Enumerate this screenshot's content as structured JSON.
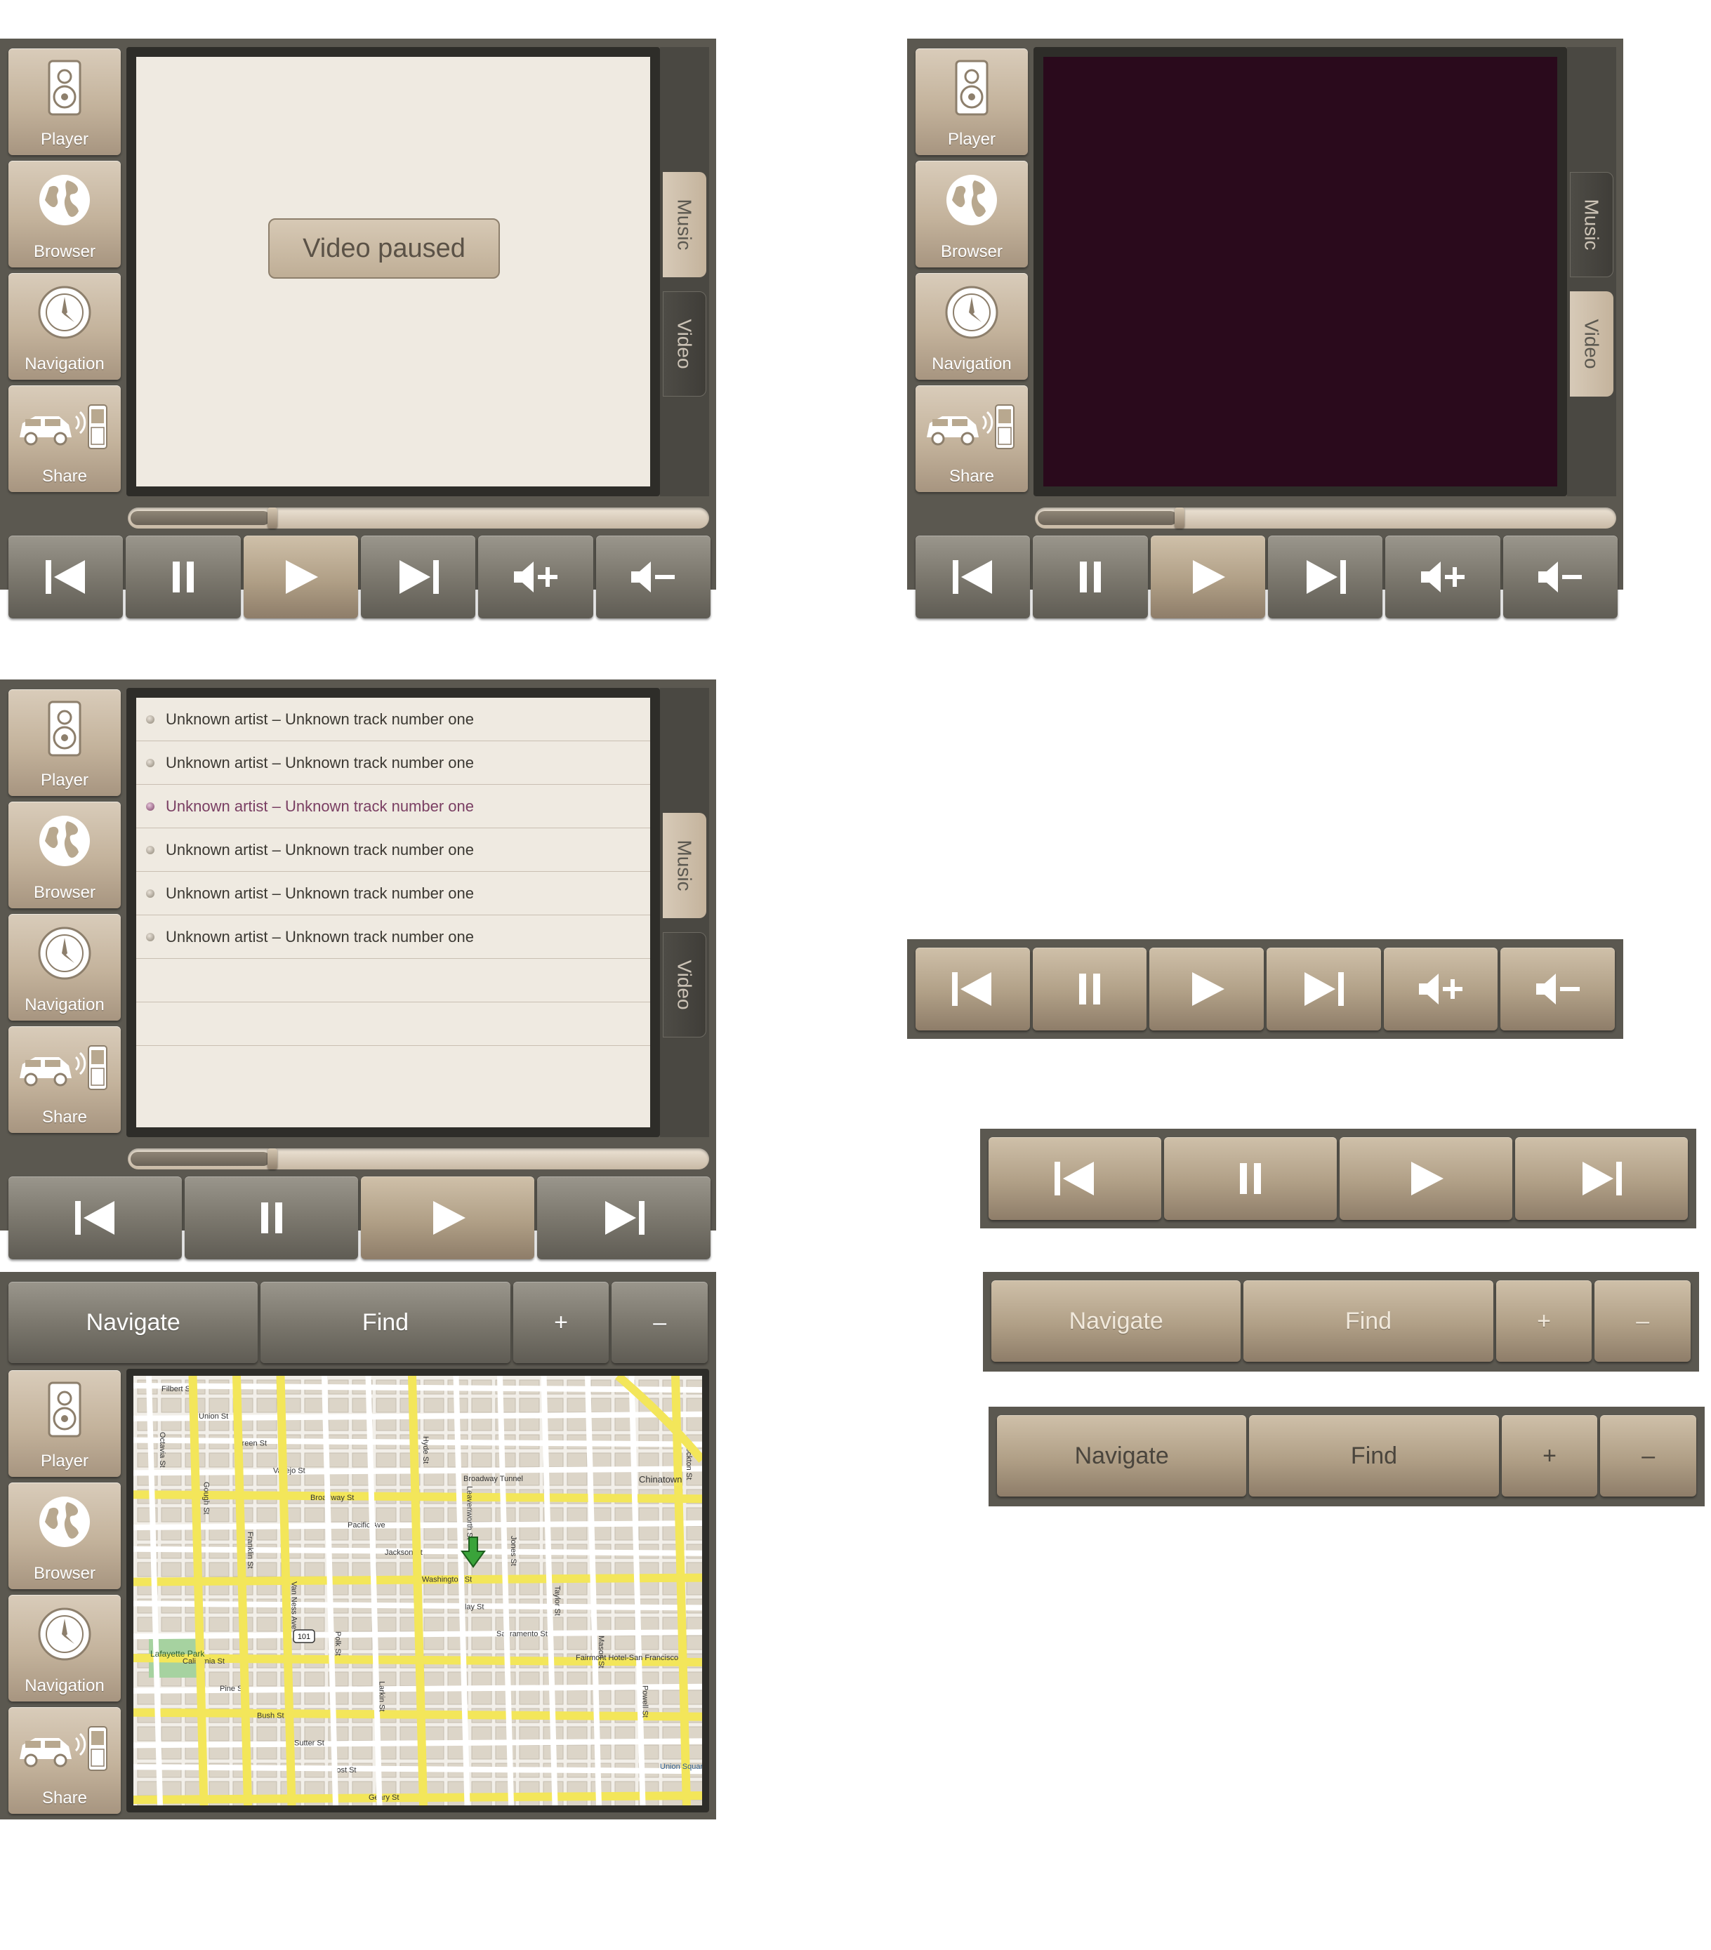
{
  "sidebar": {
    "player": "Player",
    "browser": "Browser",
    "navigation": "Navigation",
    "share": "Share"
  },
  "tabs": {
    "music": "Music",
    "video": "Video"
  },
  "video_screen": {
    "paused_label": "Video paused"
  },
  "playlist": {
    "tracks": [
      "Unknown artist – Unknown track number one",
      "Unknown artist – Unknown track number one",
      "Unknown artist – Unknown track number one",
      "Unknown artist – Unknown track number one",
      "Unknown artist – Unknown track number one",
      "Unknown artist – Unknown track number one"
    ],
    "selected_index": 2
  },
  "progress": {
    "fraction": 0.24
  },
  "map_toolbar": {
    "navigate": "Navigate",
    "find": "Find",
    "zoom_in": "+",
    "zoom_out": "–"
  },
  "map": {
    "streets": {
      "horizontal": [
        "Filbert St",
        "Union St",
        "Green St",
        "Vallejo St",
        "Broadway St",
        "Pacific Ave",
        "Jackson St",
        "Washington St",
        "Clay St",
        "Sacramento St",
        "California St",
        "Pine St",
        "Bush St",
        "Sutter St",
        "Post St",
        "Geary St"
      ],
      "vertical": [
        "Octavia St",
        "Gough St",
        "Franklin St",
        "Van Ness Ave",
        "Polk St",
        "Larkin St",
        "Hyde St",
        "Leavenworth St",
        "Jones St",
        "Taylor St",
        "Mason St",
        "Powell St",
        "Stockton St"
      ]
    },
    "labels": {
      "park": "Lafayette Park",
      "highway": "101",
      "chinatown": "Chinatown",
      "hotel": "Fairmont Hotel-San Francisco",
      "square": "Union Square",
      "tunnel": "Broadway Tunnel"
    }
  },
  "colors": {
    "frame": "#5b5850",
    "screen_bezel": "#2e2d29",
    "cream_screen": "#efeae1",
    "video_screen": "#2a0a1c",
    "accent_tan": "#b09f86",
    "highlight_text": "#7a3f63"
  }
}
